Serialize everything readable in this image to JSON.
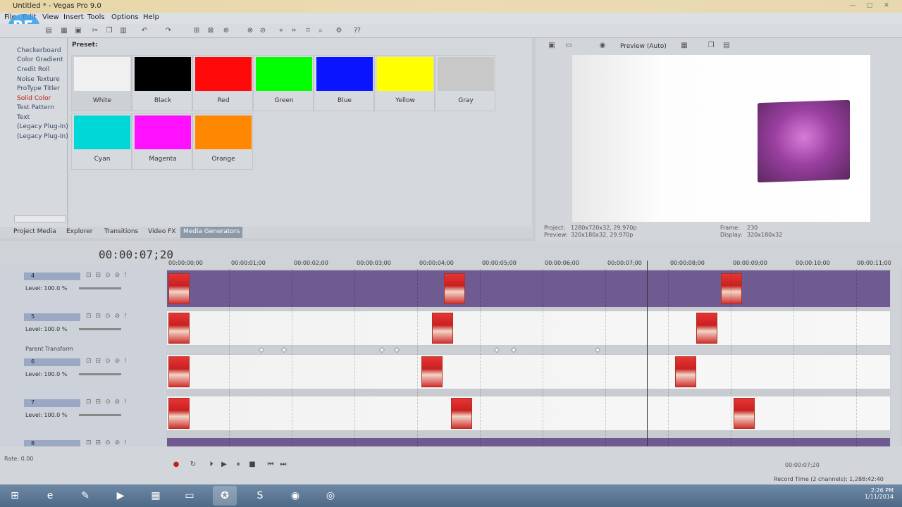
{
  "window": {
    "title": "Untitled * - Vegas Pro 9.0"
  },
  "menu": {
    "items": [
      "File",
      "Edit",
      "View",
      "Insert",
      "Tools",
      "Options",
      "Help"
    ]
  },
  "generators": {
    "items": [
      "Checkerboard",
      "Color Gradient",
      "Credit Roll",
      "Noise Texture",
      "ProType Titler",
      "Solid Color",
      "Test Pattern",
      "Text",
      "(Legacy Plug-In) T",
      "(Legacy Plug-In) V"
    ],
    "selected": "Solid Color"
  },
  "preset": {
    "label": "Preset:",
    "swatches": [
      {
        "name": "White",
        "color": "#f0f0f0"
      },
      {
        "name": "Black",
        "color": "#000000"
      },
      {
        "name": "Red",
        "color": "#ff0a0a"
      },
      {
        "name": "Green",
        "color": "#00ff00"
      },
      {
        "name": "Blue",
        "color": "#0a14ff"
      },
      {
        "name": "Yellow",
        "color": "#ffff00"
      },
      {
        "name": "Gray",
        "color": "#c8c8c8"
      },
      {
        "name": "Cyan",
        "color": "#00d8d8"
      },
      {
        "name": "Magenta",
        "color": "#ff10ff"
      },
      {
        "name": "Orange",
        "color": "#ff8800"
      }
    ]
  },
  "tabs": [
    "Project Media",
    "Explorer",
    "Transitions",
    "Video FX",
    "Media Generators"
  ],
  "active_tab": "Media Generators",
  "preview": {
    "mode": "Preview (Auto)",
    "project_label": "Project:",
    "project_value": "1280x720x32, 29.970p",
    "preview_label": "Preview:",
    "preview_value": "320x180x32, 29.970p",
    "frame_label": "Frame:",
    "frame_value": "230",
    "display_label": "Display:",
    "display_value": "320x180x32"
  },
  "timeline": {
    "timecode": "00:00:07;20",
    "ruler": [
      "00:00:00;00",
      "00:00:01;00",
      "00:00:02;00",
      "00:00:03;00",
      "00:00:04;00",
      "00:00:05;00",
      "00:00:06;00",
      "00:00:07;00",
      "00:00:08;00",
      "00:00:09;00",
      "00:00:10;00",
      "00:00:11;00"
    ],
    "tracks": [
      {
        "num": "4",
        "level": "Level: 100.0 %"
      },
      {
        "num": "5",
        "level": "Level: 100.0 %"
      },
      {
        "num": "6",
        "level": "Level: 100.0 %"
      },
      {
        "num": "7",
        "level": "Level: 100.0 %"
      },
      {
        "num": "8",
        "level": ""
      }
    ],
    "parent_transform": "Parent Transform"
  },
  "transport": {
    "rate": "Rate: 0.00",
    "end_time": "00:00:07;20",
    "record_time": "Record Time (2 channels): 1,288:42:40"
  },
  "clock": {
    "time": "2:26 PM",
    "date": "1/11/2014"
  },
  "colors": {
    "accent_purple": "#6f5a92",
    "track_header": "#cdd2da"
  }
}
